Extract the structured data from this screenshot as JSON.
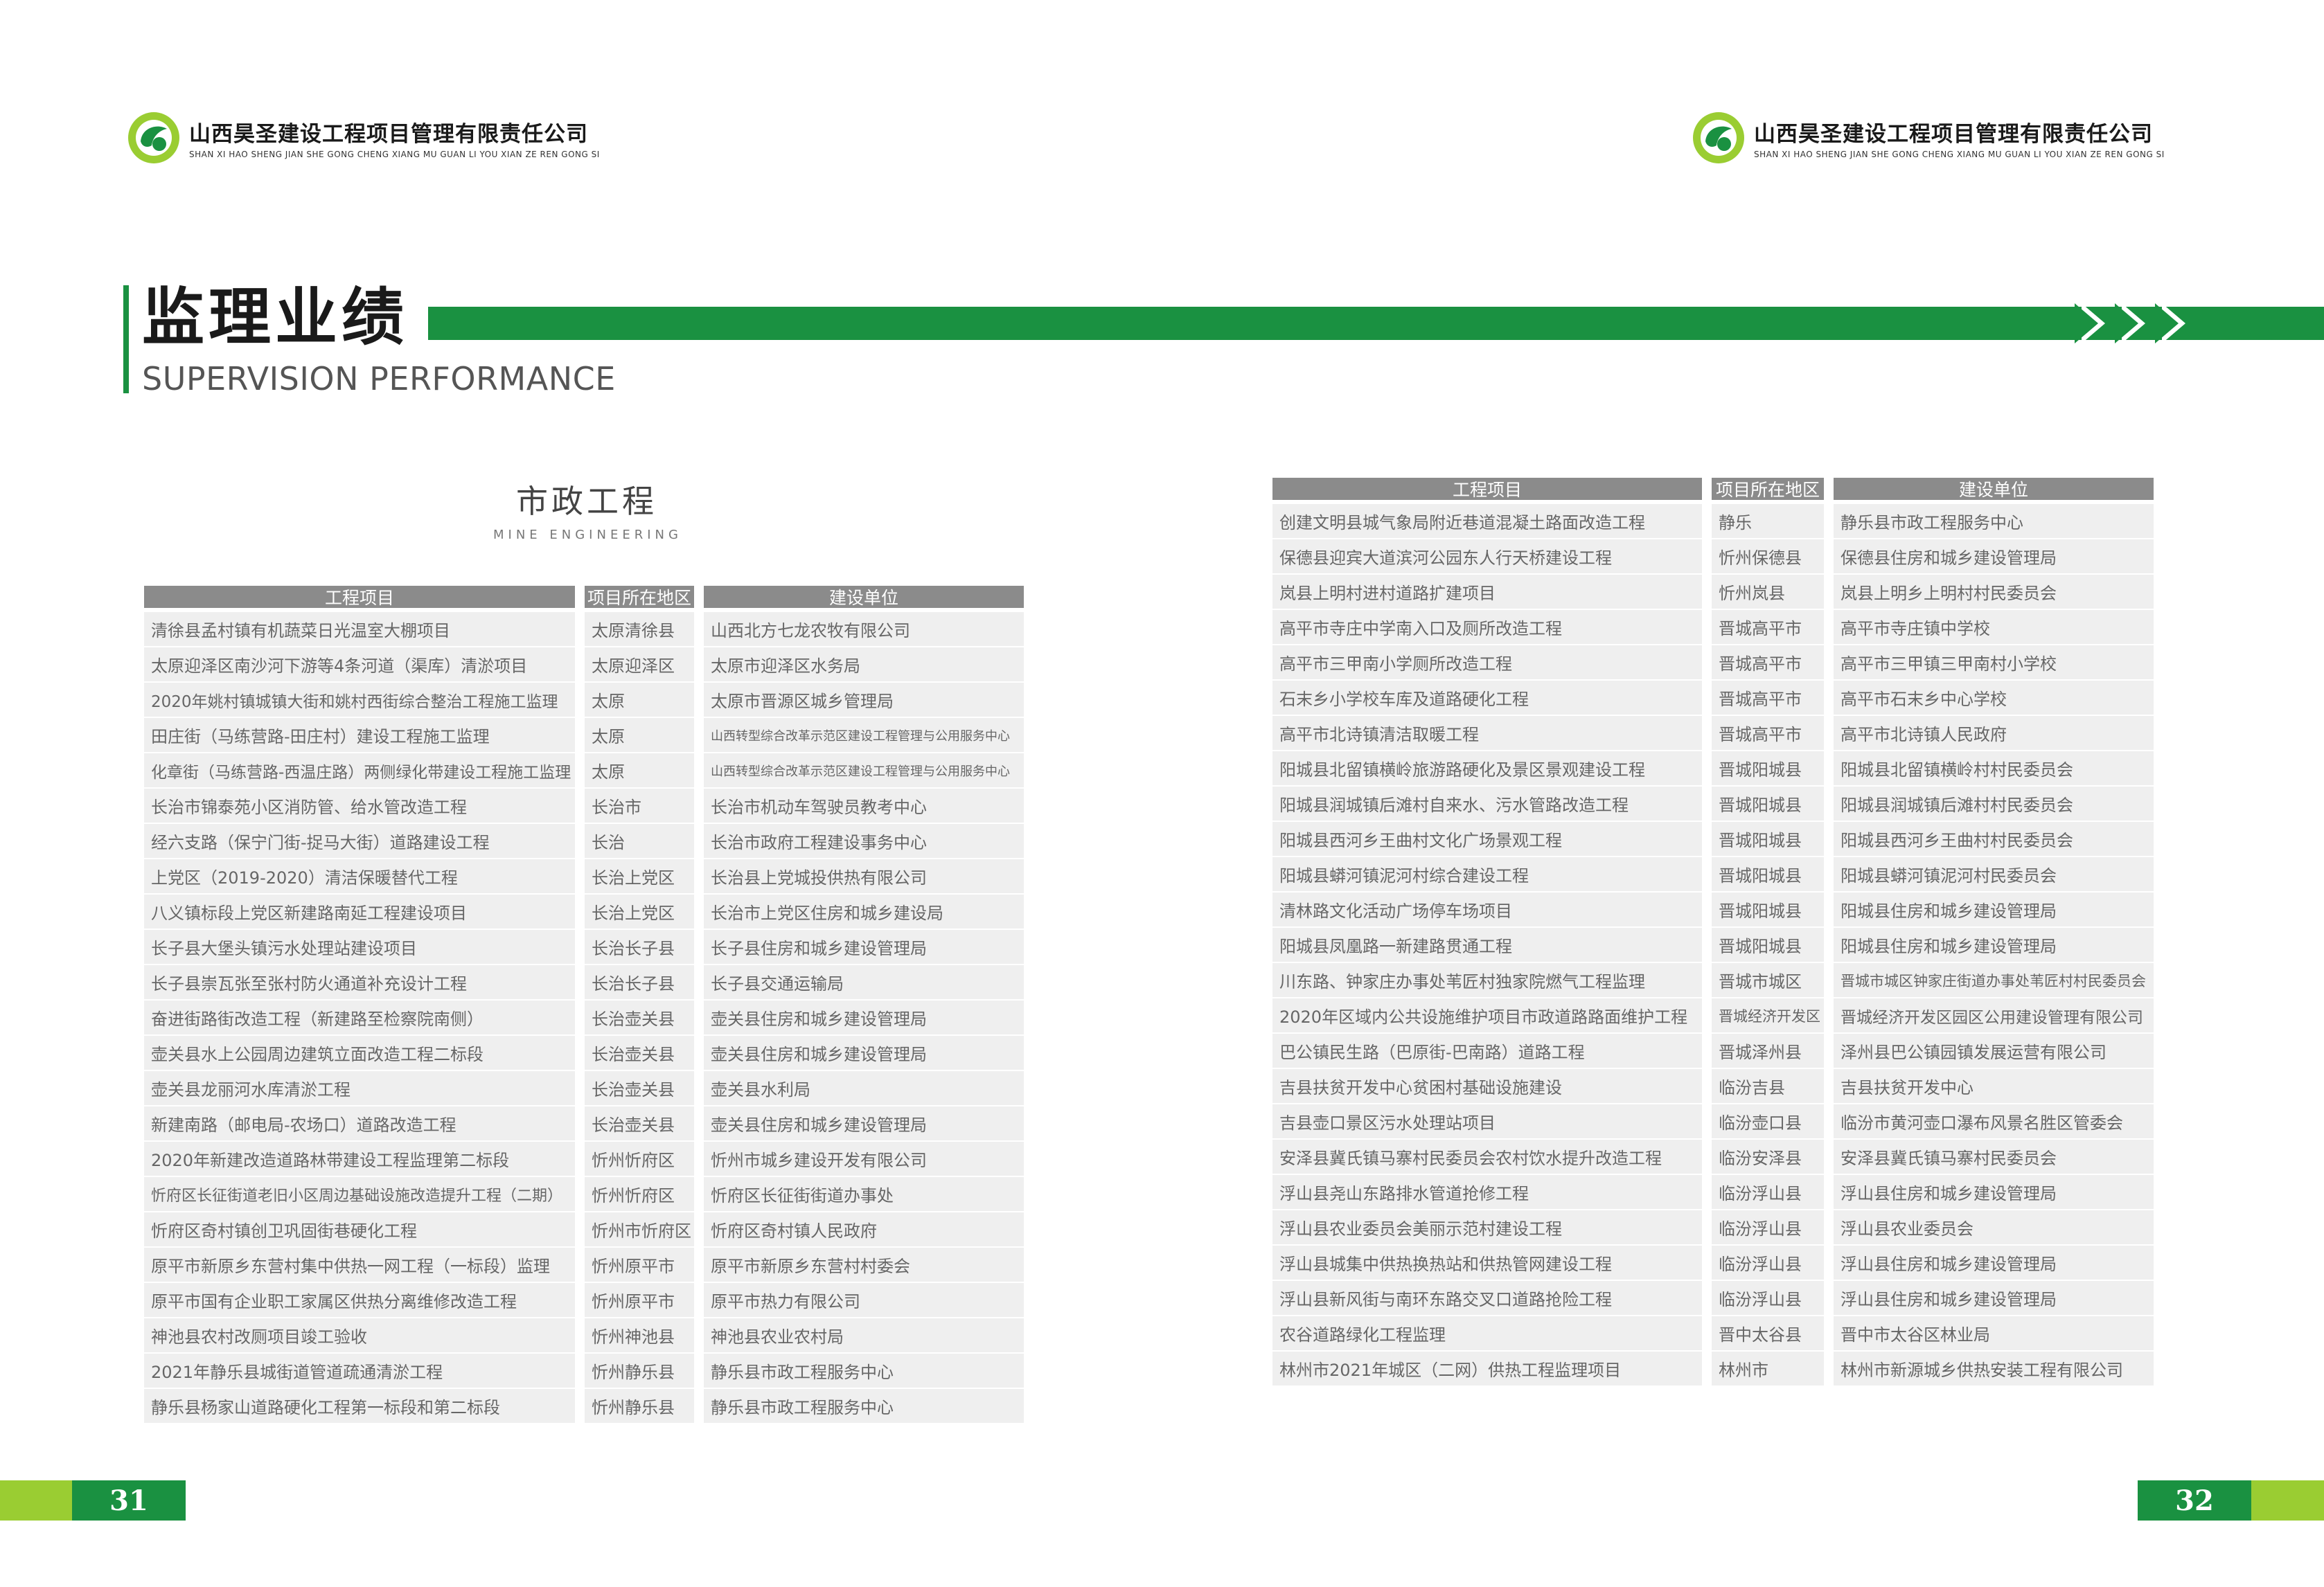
{
  "company": {
    "name_cn": "山西昊圣建设工程项目管理有限责任公司",
    "name_en": "SHAN XI HAO SHENG JIAN SHE GONG CHENG XIANG MU GUAN LI YOU XIAN ZE REN GONG SI"
  },
  "heading": {
    "title_cn": "监理业绩",
    "title_en": "SUPERVISION PERFORMANCE"
  },
  "section": {
    "title_cn": "市政工程",
    "title_en": "MINE ENGINEERING"
  },
  "table_headers": [
    "工程项目",
    "项目所在地区",
    "建设单位"
  ],
  "left_rows": [
    [
      "清徐县孟村镇有机蔬菜日光温室大棚项目",
      "太原清徐县",
      "山西北方七龙农牧有限公司"
    ],
    [
      "太原迎泽区南沙河下游等4条河道（渠库）清淤项目",
      "太原迎泽区",
      "太原市迎泽区水务局"
    ],
    [
      "2020年姚村镇城镇大街和姚村西街综合整治工程施工监理",
      "太原",
      "太原市晋源区城乡管理局"
    ],
    [
      "田庄街（马练营路-田庄村）建设工程施工监理",
      "太原",
      "山西转型综合改革示范区建设工程管理与公用服务中心"
    ],
    [
      "化章街（马练营路-西温庄路）两侧绿化带建设工程施工监理",
      "太原",
      "山西转型综合改革示范区建设工程管理与公用服务中心"
    ],
    [
      "长治市锦泰苑小区消防管、给水管改造工程",
      "长治市",
      "长治市机动车驾驶员教考中心"
    ],
    [
      "经六支路（保宁门街-捉马大街）道路建设工程",
      "长治",
      "长治市政府工程建设事务中心"
    ],
    [
      "上党区（2019-2020）清洁保暖替代工程",
      "长治上党区",
      "长治县上党城投供热有限公司"
    ],
    [
      "八义镇标段上党区新建路南延工程建设项目",
      "长治上党区",
      "长治市上党区住房和城乡建设局"
    ],
    [
      "长子县大堡头镇污水处理站建设项目",
      "长治长子县",
      "长子县住房和城乡建设管理局"
    ],
    [
      "长子县崇瓦张至张村防火通道补充设计工程",
      "长治长子县",
      "长子县交通运输局"
    ],
    [
      "奋进街路街改造工程（新建路至检察院南侧）",
      "长治壶关县",
      "壶关县住房和城乡建设管理局"
    ],
    [
      "壶关县水上公园周边建筑立面改造工程二标段",
      "长治壶关县",
      "壶关县住房和城乡建设管理局"
    ],
    [
      "壶关县龙丽河水库清淤工程",
      "长治壶关县",
      "壶关县水利局"
    ],
    [
      "新建南路（邮电局-农场口）道路改造工程",
      "长治壶关县",
      "壶关县住房和城乡建设管理局"
    ],
    [
      "2020年新建改造道路林带建设工程监理第二标段",
      "忻州忻府区",
      "忻州市城乡建设开发有限公司"
    ],
    [
      "忻府区长征街道老旧小区周边基础设施改造提升工程（二期）",
      "忻州忻府区",
      "忻府区长征街街道办事处"
    ],
    [
      "忻府区奇村镇创卫巩固街巷硬化工程",
      "忻州市忻府区",
      "忻府区奇村镇人民政府"
    ],
    [
      "原平市新原乡东营村集中供热一网工程（一标段）监理",
      "忻州原平市",
      "原平市新原乡东营村村委会"
    ],
    [
      "原平市国有企业职工家属区供热分离维修改造工程",
      "忻州原平市",
      "原平市热力有限公司"
    ],
    [
      "神池县农村改厕项目竣工验收",
      "忻州神池县",
      "神池县农业农村局"
    ],
    [
      "2021年静乐县城街道管道疏通清淤工程",
      "忻州静乐县",
      "静乐县市政工程服务中心"
    ],
    [
      "静乐县杨家山道路硬化工程第一标段和第二标段",
      "忻州静乐县",
      "静乐县市政工程服务中心"
    ]
  ],
  "right_rows": [
    [
      "创建文明县城气象局附近巷道混凝土路面改造工程",
      "静乐",
      "静乐县市政工程服务中心"
    ],
    [
      "保德县迎宾大道滨河公园东人行天桥建设工程",
      "忻州保德县",
      "保德县住房和城乡建设管理局"
    ],
    [
      "岚县上明村进村道路扩建项目",
      "忻州岚县",
      "岚县上明乡上明村村民委员会"
    ],
    [
      "高平市寺庄中学南入口及厕所改造工程",
      "晋城高平市",
      "高平市寺庄镇中学校"
    ],
    [
      "高平市三甲南小学厕所改造工程",
      "晋城高平市",
      "高平市三甲镇三甲南村小学校"
    ],
    [
      "石末乡小学校车库及道路硬化工程",
      "晋城高平市",
      "高平市石末乡中心学校"
    ],
    [
      "高平市北诗镇清洁取暖工程",
      "晋城高平市",
      "高平市北诗镇人民政府"
    ],
    [
      "阳城县北留镇横岭旅游路硬化及景区景观建设工程",
      "晋城阳城县",
      "阳城县北留镇横岭村村民委员会"
    ],
    [
      "阳城县润城镇后滩村自来水、污水管路改造工程",
      "晋城阳城县",
      "阳城县润城镇后滩村村民委员会"
    ],
    [
      "阳城县西河乡王曲村文化广场景观工程",
      "晋城阳城县",
      "阳城县西河乡王曲村村民委员会"
    ],
    [
      "阳城县蟒河镇泥河村综合建设工程",
      "晋城阳城县",
      "阳城县蟒河镇泥河村民委员会"
    ],
    [
      "清林路文化活动广场停车场项目",
      "晋城阳城县",
      "阳城县住房和城乡建设管理局"
    ],
    [
      "阳城县凤凰路一新建路贯通工程",
      "晋城阳城县",
      "阳城县住房和城乡建设管理局"
    ],
    [
      "川东路、钟家庄办事处苇匠村独家院燃气工程监理",
      "晋城市城区",
      "晋城市城区钟家庄街道办事处苇匠村村民委员会"
    ],
    [
      "2020年区域内公共设施维护项目市政道路路面维护工程",
      "晋城经济开发区",
      "晋城经济开发区园区公用建设管理有限公司"
    ],
    [
      "巴公镇民生路（巴原街-巴南路）道路工程",
      "晋城泽州县",
      "泽州县巴公镇园镇发展运营有限公司"
    ],
    [
      "吉县扶贫开发中心贫困村基础设施建设",
      "临汾吉县",
      "吉县扶贫开发中心"
    ],
    [
      "吉县壶口景区污水处理站项目",
      "临汾壶口县",
      "临汾市黄河壶口瀑布风景名胜区管委会"
    ],
    [
      "安泽县冀氏镇马寨村民委员会农村饮水提升改造工程",
      "临汾安泽县",
      "安泽县冀氏镇马寨村民委员会"
    ],
    [
      "浮山县尧山东路排水管道抢修工程",
      "临汾浮山县",
      "浮山县住房和城乡建设管理局"
    ],
    [
      "浮山县农业委员会美丽示范村建设工程",
      "临汾浮山县",
      "浮山县农业委员会"
    ],
    [
      "浮山县城集中供热换热站和供热管网建设工程",
      "临汾浮山县",
      "浮山县住房和城乡建设管理局"
    ],
    [
      "浮山县新风街与南环东路交叉口道路抢险工程",
      "临汾浮山县",
      "浮山县住房和城乡建设管理局"
    ],
    [
      "农谷道路绿化工程监理",
      "晋中太谷县",
      "晋中市太谷区林业局"
    ],
    [
      "林州市2021年城区（二网）供热工程监理项目",
      "林州市",
      "林州市新源城乡供热安装工程有限公司"
    ]
  ],
  "page_numbers": {
    "left": "31",
    "right": "32"
  },
  "colors": {
    "green": "#1a9141",
    "lime": "#9acd32",
    "header_gray": "#8b8b8b",
    "row_gray": "#efefef"
  }
}
